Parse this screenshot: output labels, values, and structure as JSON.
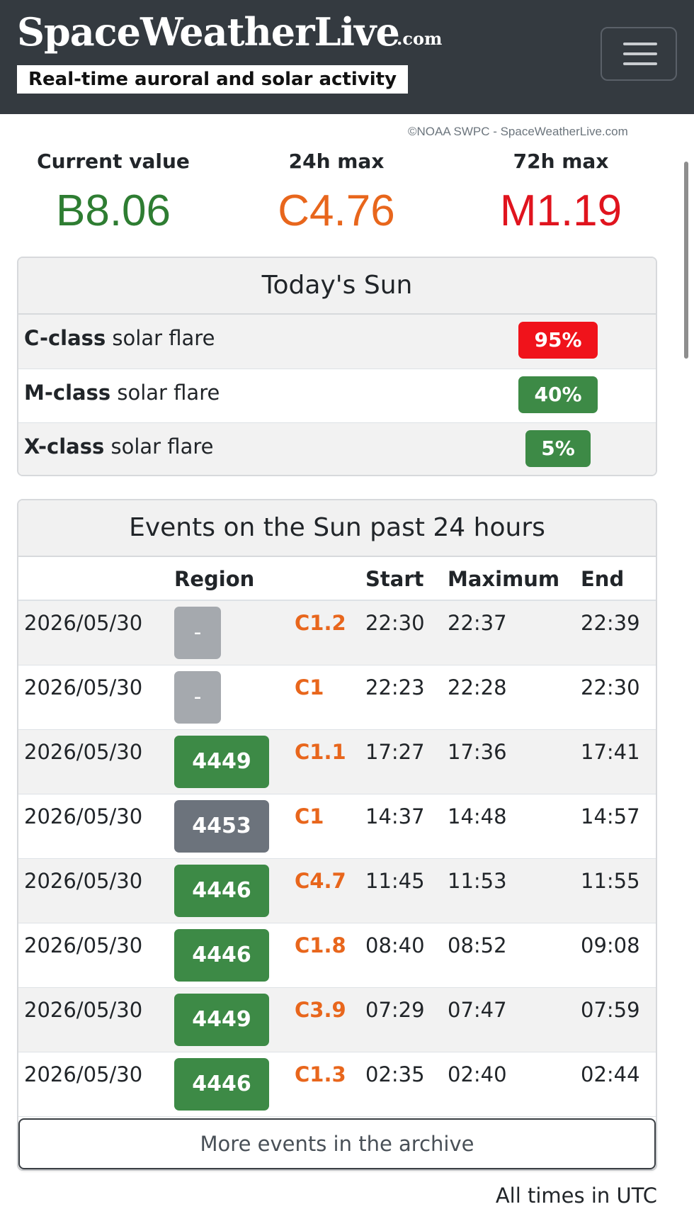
{
  "header": {
    "logo": "SpaceWeatherLive",
    "logo_suffix": ".com",
    "tagline": "Real-time auroral and solar activity",
    "menu_icon": "hamburger-menu-icon"
  },
  "credit": "©NOAA SWPC - SpaceWeatherLive.com",
  "stats": {
    "current": {
      "label": "Current value",
      "value": "B8.06",
      "color": "#2e7d32"
    },
    "max24": {
      "label": "24h max",
      "value": "C4.76",
      "color": "#e8661c"
    },
    "max72": {
      "label": "72h max",
      "value": "M1.19",
      "color": "#e0141e"
    }
  },
  "todays_sun": {
    "title": "Today's Sun",
    "rows": [
      {
        "class": "C-class",
        "text": " solar flare",
        "prob": "95%",
        "color": "#f0131b"
      },
      {
        "class": "M-class",
        "text": " solar flare",
        "prob": "40%",
        "color": "#3d8a46"
      },
      {
        "class": "X-class",
        "text": " solar flare",
        "prob": "5%",
        "color": "#3d8a46"
      }
    ]
  },
  "events": {
    "title": "Events on the Sun past 24 hours",
    "columns": {
      "region": "Region",
      "start": "Start",
      "maximum": "Maximum",
      "end": "End"
    },
    "rows": [
      {
        "date": "2026/05/30",
        "region": "-",
        "region_color": "#a5a9ae",
        "class": "C1.2",
        "start": "22:30",
        "max": "22:37",
        "end": "22:39"
      },
      {
        "date": "2026/05/30",
        "region": "-",
        "region_color": "#a5a9ae",
        "class": "C1",
        "start": "22:23",
        "max": "22:28",
        "end": "22:30"
      },
      {
        "date": "2026/05/30",
        "region": "4449",
        "region_color": "#3d8a46",
        "class": "C1.1",
        "start": "17:27",
        "max": "17:36",
        "end": "17:41"
      },
      {
        "date": "2026/05/30",
        "region": "4453",
        "region_color": "#6c737c",
        "class": "C1",
        "start": "14:37",
        "max": "14:48",
        "end": "14:57"
      },
      {
        "date": "2026/05/30",
        "region": "4446",
        "region_color": "#3d8a46",
        "class": "C4.7",
        "start": "11:45",
        "max": "11:53",
        "end": "11:55"
      },
      {
        "date": "2026/05/30",
        "region": "4446",
        "region_color": "#3d8a46",
        "class": "C1.8",
        "start": "08:40",
        "max": "08:52",
        "end": "09:08"
      },
      {
        "date": "2026/05/30",
        "region": "4449",
        "region_color": "#3d8a46",
        "class": "C3.9",
        "start": "07:29",
        "max": "07:47",
        "end": "07:59"
      },
      {
        "date": "2026/05/30",
        "region": "4446",
        "region_color": "#3d8a46",
        "class": "C1.3",
        "start": "02:35",
        "max": "02:40",
        "end": "02:44"
      }
    ],
    "archive_button": "More events in the archive"
  },
  "footer_note": "All times in UTC"
}
